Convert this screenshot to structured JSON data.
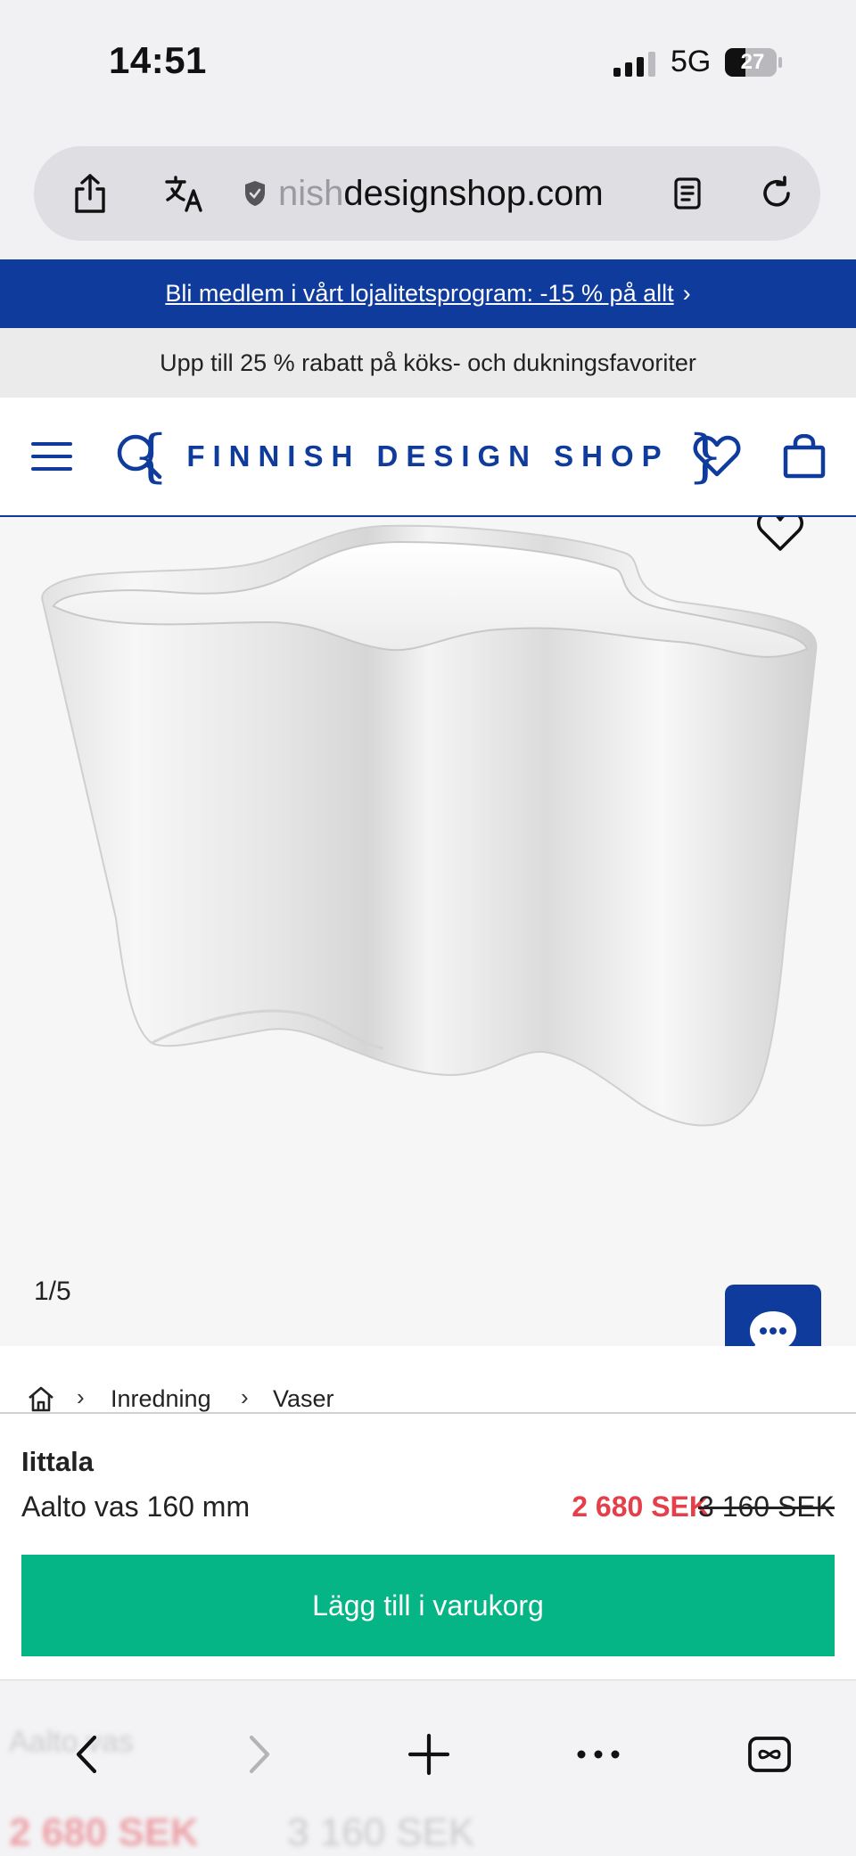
{
  "status_bar": {
    "time": "14:51",
    "network": "5G",
    "battery": "27"
  },
  "browser": {
    "url_faded": "nish",
    "url_main": "designshop.com"
  },
  "banners": {
    "loyalty": "Bli medlem i vårt lojalitetsprogram: -15 % på allt",
    "loyalty_arrow": "›",
    "sale": "Upp till 25 % rabatt på köks- och dukningsfavoriter"
  },
  "header": {
    "logo": "FINNISH DESIGN SHOP",
    "logo_brace_left": "{",
    "logo_brace_right": "}",
    "accent_color": "#0f3b9c"
  },
  "gallery": {
    "counter": "1/5"
  },
  "breadcrumb": {
    "items": [
      "Inredning",
      "Vaser"
    ],
    "separator": "›"
  },
  "product": {
    "brand": "Iittala",
    "name": "Aalto vas 160 mm",
    "price_sale": "2 680 SEK",
    "price_old": "3 160 SEK",
    "sale_color": "#e43f4a"
  },
  "cart": {
    "button_label": "Lägg till i varukorg",
    "button_color": "#05b585"
  },
  "ghost_content": {
    "name": "Aalto vas",
    "price_sale": "2 680 SEK",
    "price_old": "3 160 SEK"
  },
  "icons": {
    "share": "share-icon",
    "translate": "translate-icon",
    "shield": "shield-icon",
    "reader": "reader-icon",
    "reload": "reload-icon",
    "menu": "menu-icon",
    "search": "search-icon",
    "heart": "heart-icon",
    "bag": "bag-icon",
    "chat": "chat-icon",
    "home": "home-icon",
    "back": "back-icon",
    "forward": "forward-icon",
    "new_tab": "plus-icon",
    "more": "more-icon",
    "tabs": "tabs-icon"
  }
}
